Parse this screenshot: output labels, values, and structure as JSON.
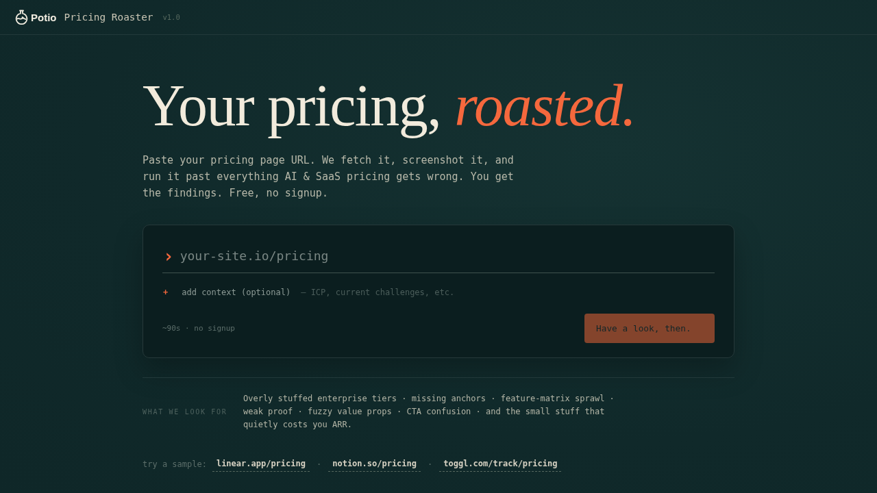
{
  "header": {
    "brand": "Potio",
    "app_name": "Pricing Roaster",
    "version": "v1.0"
  },
  "hero": {
    "headline": "Your pricing, *roasted.*",
    "intro": "Paste your pricing page URL. We fetch it, screenshot it, and run it past everything AI & SaaS pricing gets wrong. You get the findings. Free, no signup."
  },
  "form": {
    "prompt": "›",
    "url_field": {
      "placeholder": "your-site.io/pricing"
    },
    "context_toggle": {
      "icon": "+",
      "label": "add context (optional)",
      "hint": "— ICP, current challenges, etc."
    },
    "note": "~90s · no signup",
    "submit": "Have a look, then."
  },
  "criteria": {
    "label": "WHAT WE LOOK FOR",
    "text": "Overly stuffed enterprise tiers · missing anchors · feature-matrix sprawl · weak proof · fuzzy value props · CTA confusion · and the small stuff that quietly costs you ARR."
  },
  "samples": {
    "label": "try a sample:",
    "links": [
      "linear.app/pricing",
      "notion.so/pricing",
      "toggl.com/track/pricing"
    ],
    "separators": [
      "·",
      "·"
    ]
  }
}
